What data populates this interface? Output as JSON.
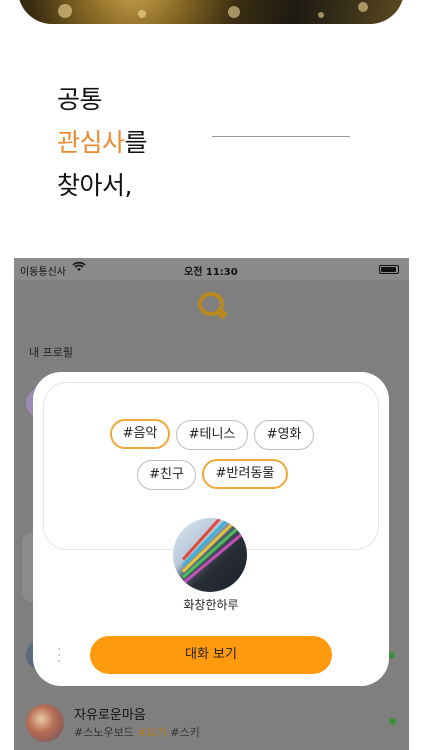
{
  "headline": {
    "line1": "공통",
    "line2_accent": "관심사",
    "line2_rest": "를",
    "line3": "찾아서,"
  },
  "status_bar": {
    "carrier": "이동통신사",
    "time": "오전 11:30"
  },
  "screen": {
    "profile_label": "내 프로필"
  },
  "modal": {
    "chips_row1": [
      {
        "label": "#음악",
        "selected": true
      },
      {
        "label": "#테니스",
        "selected": false
      },
      {
        "label": "#영화",
        "selected": false
      }
    ],
    "chips_row2": [
      {
        "label": "#친구",
        "selected": false
      },
      {
        "label": "#반려동물",
        "selected": true
      }
    ],
    "nickname": "화창한하루",
    "button_label": "대화 보기",
    "more_icon": "more-vertical-icon"
  },
  "list": [
    {
      "name": "자유로운마음",
      "tags": [
        "#스노우보드",
        "#요가",
        "#스키"
      ],
      "highlighted_tag": "#요가"
    }
  ],
  "colors": {
    "accent": "#ee8a2e",
    "button": "#ff9a0f",
    "chip_selected_border": "#f0a83a",
    "online": "#3e8e3e"
  }
}
